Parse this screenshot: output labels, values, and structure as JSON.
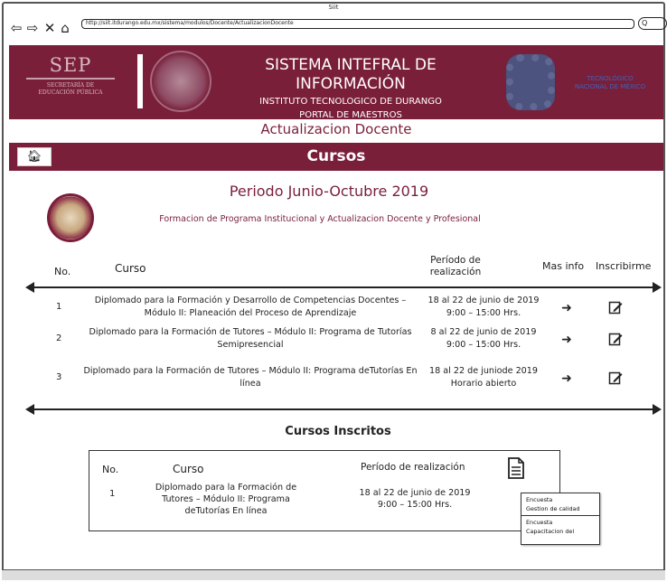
{
  "browser": {
    "title": "Siit",
    "url": "http://siit.itdurango.edu.mx/sistema/modulos/Docente/ActualizacionDocente",
    "search_label": "Q"
  },
  "header": {
    "sep_big": "SEP",
    "sep_small_1": "SECRETARÍA DE",
    "sep_small_2": "EDUCACIÓN PÚBLICA",
    "title": "SISTEMA INTEFRAL DE INFORMACIÓN",
    "subtitle": "INSTITUTO TECNOLOGICO DE DURANGO",
    "portal": "PORTAL DE MAESTROS",
    "tec_line_1": "TECNOLÓGICO",
    "tec_line_2": "NACIONAL DE MÉXICO"
  },
  "page_heading": "Actualizacion Docente",
  "section_title": "Cursos",
  "periodo": "Periodo Junio-Octubre 2019",
  "programa": "Formacion de Programa Institucional y Actualizacion Docente y Profesional",
  "table": {
    "headers": {
      "no": "No.",
      "curso": "Curso",
      "periodo": "Período de realización",
      "info": "Mas info",
      "inscribirme": "Inscribirme"
    },
    "rows": [
      {
        "no": "1",
        "curso": "Diplomado para la Formación y Desarrollo de Competencias Docentes – Módulo II: Planeación del Proceso de Aprendizaje",
        "fecha": "18 al 22 de junio de 2019",
        "horario": "9:00 – 15:00 Hrs."
      },
      {
        "no": "2",
        "curso": "Diplomado para la Formación de Tutores – Módulo II: Programa de Tutorías Semipresencial",
        "fecha": "8 al 22 de junio de 2019",
        "horario": "9:00 – 15:00 Hrs."
      },
      {
        "no": "3",
        "curso": "Diplomado para la Formación de Tutores – Módulo II: Programa deTutorías En línea",
        "fecha": "18 al 22 de juniode 2019",
        "horario": "Horario abierto"
      }
    ]
  },
  "inscritos": {
    "title": "Cursos Inscritos",
    "headers": {
      "no": "No.",
      "curso": "Curso",
      "periodo": "Período de realización"
    },
    "row": {
      "no": "1",
      "curso": "Diplomado para la Formación de Tutores – Módulo II: Programa deTutorías En línea",
      "fecha": "18 al 22 de junio de 2019",
      "horario": "9:00 – 15:00 Hrs."
    }
  },
  "dropdown": {
    "item1_line1": "Encuesta",
    "item1_line2": "Gestion de calidad",
    "item2_line1": "Encuesta",
    "item2_line2": "Capacitacion del"
  }
}
